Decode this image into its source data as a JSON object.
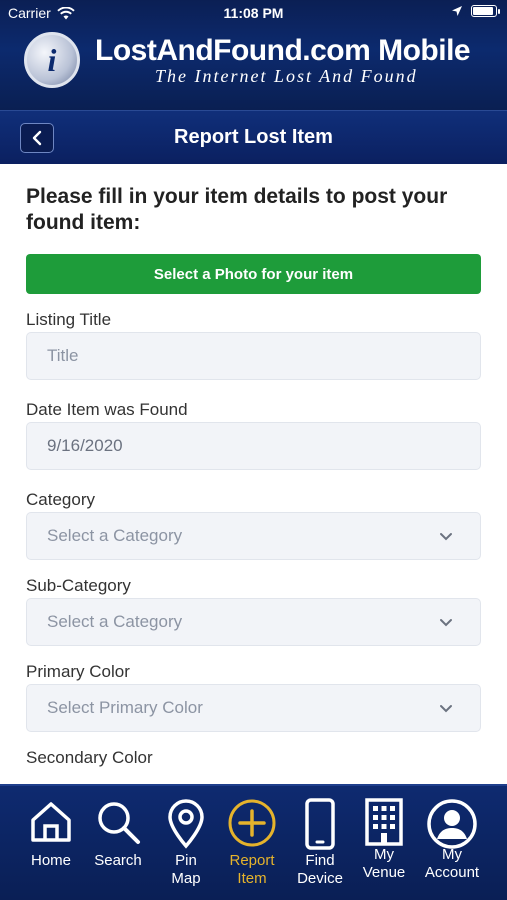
{
  "status_bar": {
    "carrier": "Carrier",
    "time": "11:08 PM"
  },
  "header": {
    "brand_title": "LostAndFound.com Mobile",
    "brand_subtitle": "The Internet Lost And Found"
  },
  "nav": {
    "title": "Report Lost Item"
  },
  "form": {
    "intro": "Please fill in your item details to post your found item:",
    "photo_button": "Select a Photo for your item",
    "listing_title_label": "Listing Title",
    "listing_title_placeholder": "Title",
    "date_label": "Date Item was Found",
    "date_value": "9/16/2020",
    "category_label": "Category",
    "category_value": "Select a Category",
    "subcategory_label": "Sub-Category",
    "subcategory_value": "Select a Category",
    "primary_color_label": "Primary Color",
    "primary_color_value": "Select Primary Color",
    "secondary_color_label": "Secondary Color"
  },
  "tabs": [
    {
      "label1": "Home",
      "label2": "",
      "icon": "home-icon"
    },
    {
      "label1": "Search",
      "label2": "",
      "icon": "search-icon"
    },
    {
      "label1": "Pin",
      "label2": "Map",
      "icon": "map-pin-icon"
    },
    {
      "label1": "Report",
      "label2": "Item",
      "icon": "plus-circle-icon"
    },
    {
      "label1": "Find",
      "label2": "Device",
      "icon": "phone-icon"
    },
    {
      "label1": "My",
      "label2": "Venue",
      "icon": "building-icon"
    },
    {
      "label1": "My",
      "label2": "Account",
      "icon": "account-icon"
    }
  ],
  "colors": {
    "header_bg": "#0c2a6e",
    "photo_button_bg": "#1e9c3a",
    "active_tab": "#e5b32c"
  }
}
